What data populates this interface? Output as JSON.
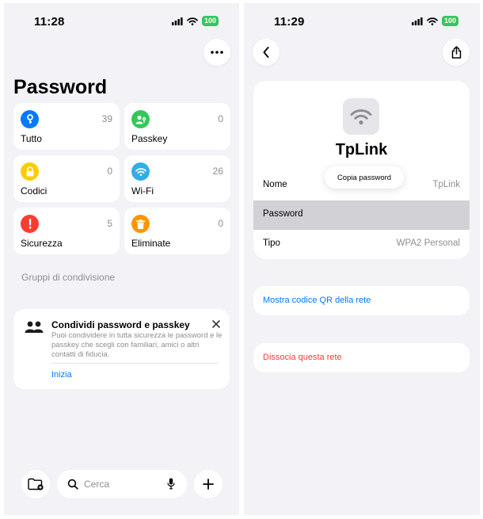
{
  "left": {
    "status": {
      "time": "11:28",
      "battery": "100"
    },
    "title": "Password",
    "tiles": [
      {
        "label": "Tutto",
        "count": "39",
        "color": "#007aff",
        "icon": "key-icon"
      },
      {
        "label": "Passkey",
        "count": "0",
        "color": "#34c759",
        "icon": "person-key-icon"
      },
      {
        "label": "Codici",
        "count": "0",
        "color": "#ffcc00",
        "icon": "lock-icon"
      },
      {
        "label": "Wi-Fi",
        "count": "26",
        "color": "#32ade6",
        "icon": "wifi-icon"
      },
      {
        "label": "Sicurezza",
        "count": "5",
        "color": "#ff3b30",
        "icon": "exclamation-icon"
      },
      {
        "label": "Eliminate",
        "count": "0",
        "color": "#ff9500",
        "icon": "trash-icon"
      }
    ],
    "section_label": "Gruppi di condivisione",
    "share_card": {
      "title": "Condividi password e passkey",
      "description": "Puoi condividere in tutta sicurezza le password e le passkey che scegli con familiari, amici o altri contatti di fiducia.",
      "link": "Inizia"
    },
    "search": {
      "placeholder": "Cerca"
    }
  },
  "right": {
    "status": {
      "time": "11:29",
      "battery": "100"
    },
    "network_name": "TpLink",
    "tooltip": "Copia password",
    "rows": [
      {
        "key": "Nome",
        "value": "TpLink"
      },
      {
        "key": "Password",
        "value": ""
      },
      {
        "key": "Tipo",
        "value": "WPA2 Personal"
      }
    ],
    "qr_action": "Mostra codice QR della rete",
    "forget_action": "Dissocia questa rete"
  },
  "colors": {
    "accent": "#007aff",
    "destructive": "#ff3b30",
    "background": "#f2f2f7"
  }
}
